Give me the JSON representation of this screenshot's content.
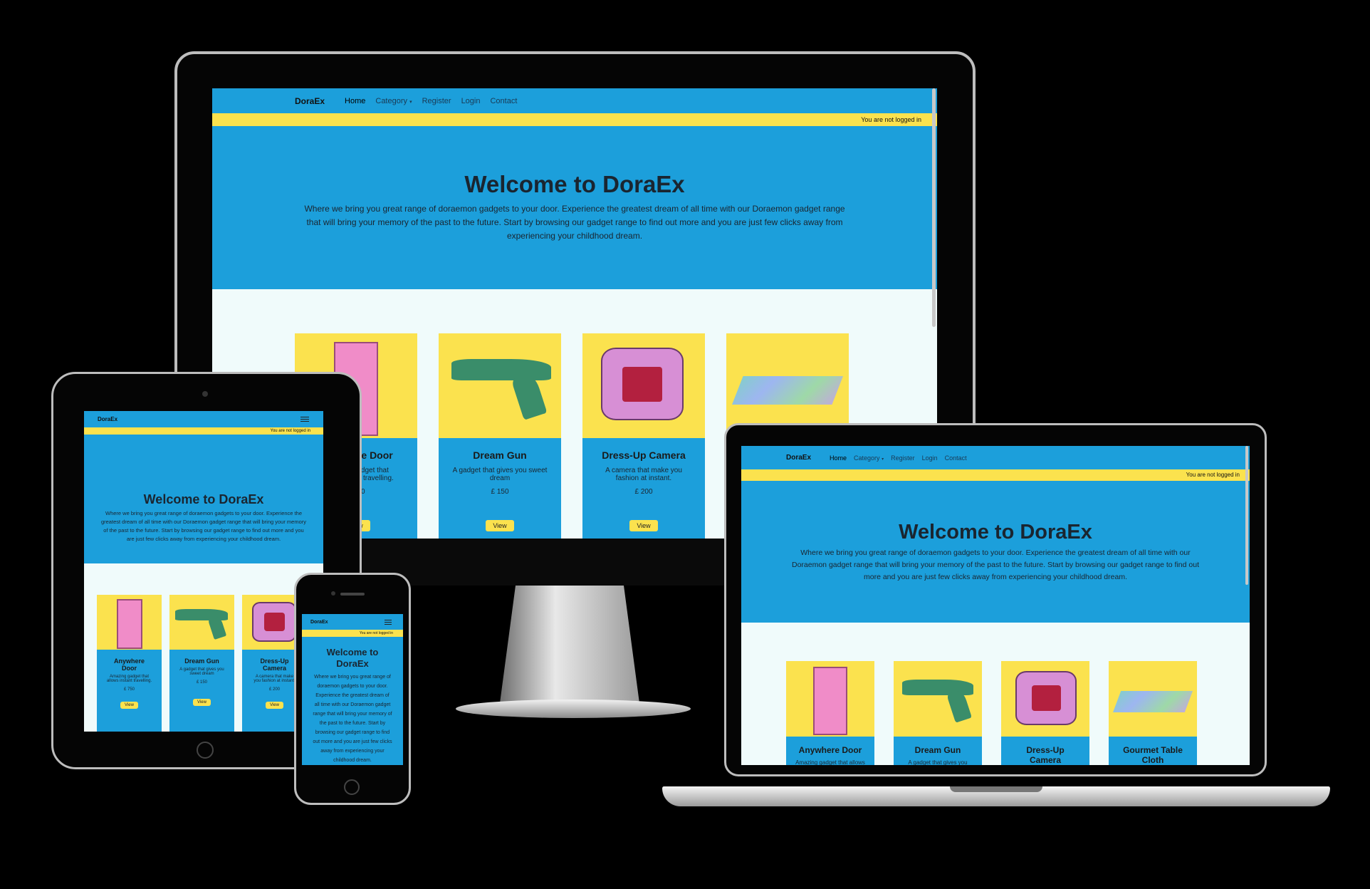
{
  "site": {
    "brand": "DoraEx",
    "nav": {
      "home": "Home",
      "category": "Category",
      "register": "Register",
      "login": "Login",
      "contact": "Contact"
    },
    "status": "You are not logged in",
    "hero_title": "Welcome to DoraEx",
    "hero_text": "Where we bring you great range of doraemon gadgets to your door. Experience the greatest dream of all time with our Doraemon gadget range that will bring your memory of the past to the future. Start by browsing our gadget range to find out more and you are just few clicks away from experiencing your childhood dream.",
    "view_label": "View"
  },
  "products": [
    {
      "name": "Anywhere Door",
      "desc": "Amazing gadget that allows instant travelling.",
      "price": "£ 750",
      "icon": "door-image"
    },
    {
      "name": "Dream Gun",
      "desc": "A gadget that gives you sweet dream",
      "price": "£ 150",
      "icon": "gun-image"
    },
    {
      "name": "Dress-Up Camera",
      "desc": "A camera that make you fashion at instant.",
      "price": "£ 200",
      "icon": "camera-image"
    },
    {
      "name": "Gourmet Table Cloth",
      "desc": "",
      "price": "",
      "icon": "tablecloth-image"
    }
  ],
  "colors": {
    "primary": "#1c9fdb",
    "accent": "#fbe24e",
    "background": "#f0fbfb"
  }
}
